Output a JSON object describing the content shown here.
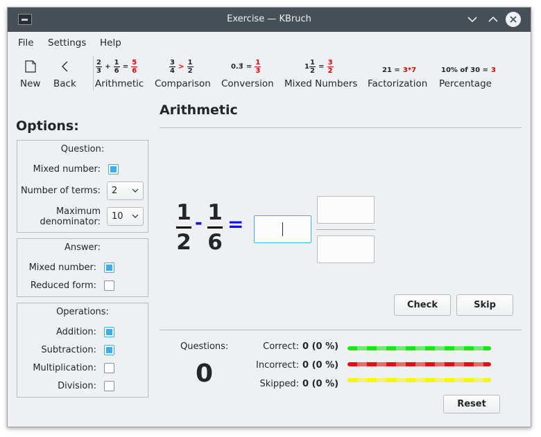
{
  "window": {
    "title": "Exercise — KBruch"
  },
  "menu": [
    "File",
    "Settings",
    "Help"
  ],
  "toolbar": {
    "new_label": "New",
    "back_label": "Back",
    "exercises": [
      {
        "label": "Arithmetic"
      },
      {
        "label": "Comparison"
      },
      {
        "label": "Conversion"
      },
      {
        "label": "Mixed Numbers"
      },
      {
        "label": "Factorization"
      },
      {
        "label": "Percentage"
      }
    ],
    "icons": {
      "arith": {
        "a_n": "2",
        "a_d": "3",
        "op": "+",
        "b_n": "1",
        "b_d": "6",
        "eq": "=",
        "r_n": "5",
        "r_d": "6"
      },
      "comp": {
        "a_n": "3",
        "a_d": "4",
        "op": ">",
        "b_n": "1",
        "b_d": "2"
      },
      "conv": {
        "dec": "0.3̄",
        "eq": "=",
        "r_n": "1",
        "r_d": "3"
      },
      "mixed": {
        "whole": "1",
        "a_n": "1",
        "a_d": "2",
        "eq": "=",
        "r_n": "3",
        "r_d": "2"
      },
      "factor": {
        "lhs": "21 =",
        "rhs": "3*7"
      },
      "percent": {
        "lhs": "10% of 30 =",
        "rhs": "3"
      }
    }
  },
  "options": {
    "title": "Options:",
    "question": {
      "title": "Question:",
      "mixed_label": "Mixed number:",
      "mixed_checked": true,
      "terms_label": "Number of terms:",
      "terms_value": "2",
      "maxden_label1": "Maximum",
      "maxden_label2": "denominator:",
      "maxden_value": "10"
    },
    "answer": {
      "title": "Answer:",
      "mixed_label": "Mixed number:",
      "mixed_checked": true,
      "reduced_label": "Reduced form:",
      "reduced_checked": false
    },
    "operations": {
      "title": "Operations:",
      "items": [
        {
          "label": "Addition:",
          "checked": true
        },
        {
          "label": "Subtraction:",
          "checked": true
        },
        {
          "label": "Multiplication:",
          "checked": false
        },
        {
          "label": "Division:",
          "checked": false
        }
      ]
    }
  },
  "exercise": {
    "heading": "Arithmetic",
    "frac1": {
      "num": "1",
      "den": "2"
    },
    "operator": "-",
    "frac2": {
      "num": "1",
      "den": "6"
    },
    "equals": "=",
    "check_label": "Check",
    "skip_label": "Skip"
  },
  "stats": {
    "questions_label": "Questions:",
    "questions_value": "0",
    "correct_label": "Correct:",
    "correct_value": "0 (0 %)",
    "incorrect_label": "Incorrect:",
    "incorrect_value": "0 (0 %)",
    "skipped_label": "Skipped:",
    "skipped_value": "0 (0 %)",
    "reset_label": "Reset",
    "colors": {
      "correct": "#19e619",
      "incorrect": "#e60f0f",
      "skipped": "#f5f50f"
    }
  }
}
